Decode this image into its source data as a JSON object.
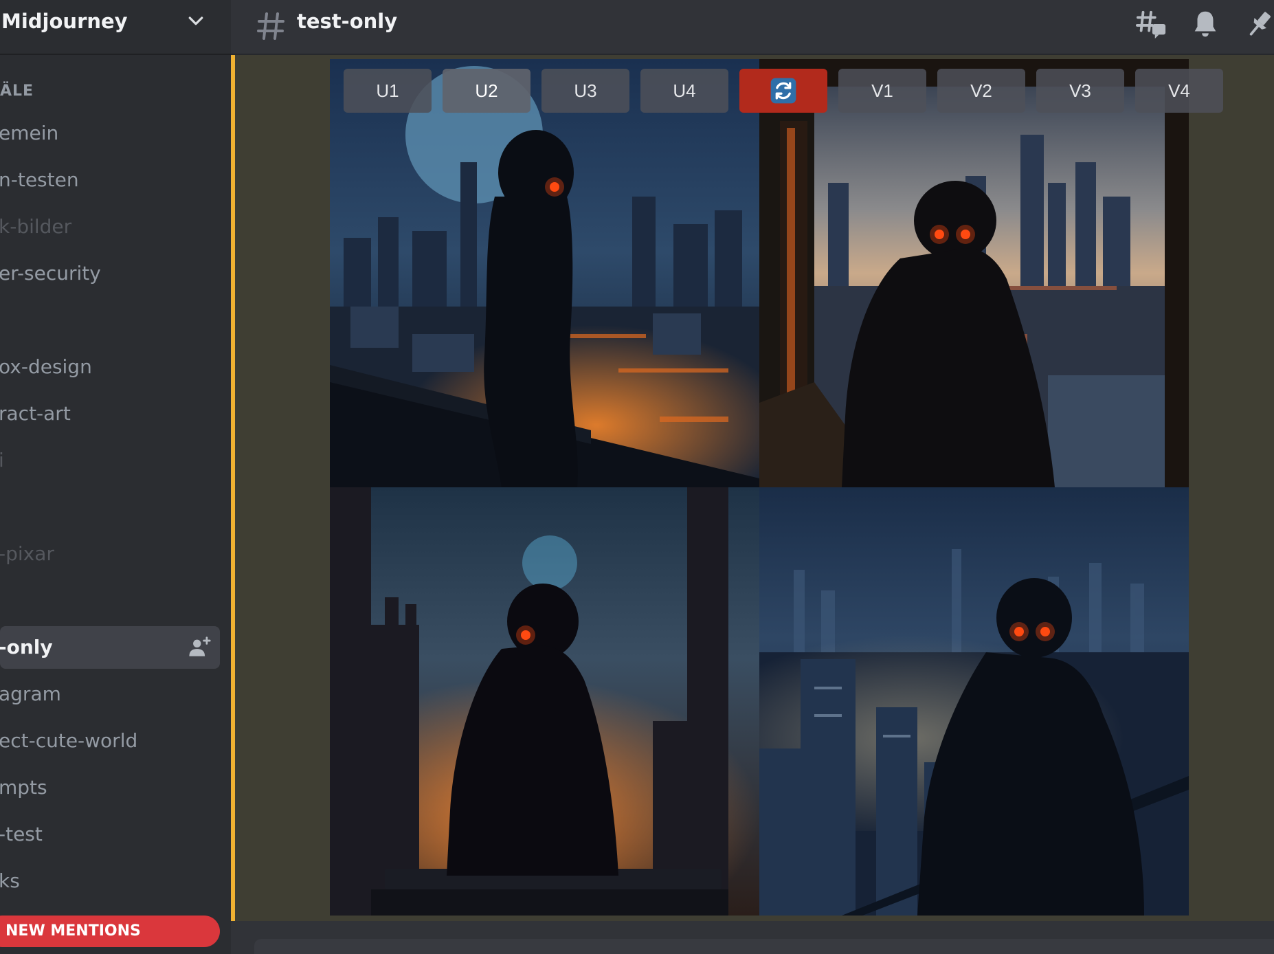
{
  "server": {
    "name": "Midjourney",
    "menu_icon": "chevron-down-icon"
  },
  "sidebar": {
    "category_label": "ÄLE",
    "channels": [
      {
        "label": "emein",
        "state": "normal"
      },
      {
        "label": "n-testen",
        "state": "normal"
      },
      {
        "label": "k-bilder",
        "state": "muted"
      },
      {
        "label": "er-security",
        "state": "normal"
      },
      {
        "label": "ox-design",
        "state": "normal"
      },
      {
        "label": "ract-art",
        "state": "normal"
      },
      {
        "label": "i",
        "state": "muted"
      },
      {
        "label": "-pixar",
        "state": "muted"
      },
      {
        "label": "-only",
        "state": "active"
      },
      {
        "label": "agram",
        "state": "normal"
      },
      {
        "label": "ect-cute-world",
        "state": "normal"
      },
      {
        "label": "mpts",
        "state": "normal"
      },
      {
        "label": "-test",
        "state": "normal"
      },
      {
        "label": "ks",
        "state": "normal"
      }
    ],
    "active_channel_action_icon": "add-member-icon",
    "new_mentions_label": "NEW MENTIONS"
  },
  "header": {
    "channel_icon": "hash-icon",
    "channel_name": "test-only",
    "icons": [
      "threads-icon",
      "bell-icon",
      "pin-icon"
    ]
  },
  "message": {
    "image_grid_panels": 4,
    "actions": [
      {
        "label": "U1",
        "state": "normal"
      },
      {
        "label": "U2",
        "state": "selected"
      },
      {
        "label": "U3",
        "state": "normal"
      },
      {
        "label": "U4",
        "state": "normal"
      },
      {
        "label": "",
        "icon": "reroll-icon",
        "state": "reroll"
      },
      {
        "label": "V1",
        "state": "normal"
      },
      {
        "label": "V2",
        "state": "normal"
      },
      {
        "label": "V3",
        "state": "normal"
      },
      {
        "label": "V4",
        "state": "normal"
      }
    ]
  },
  "colors": {
    "sidebar_bg": "#2b2d31",
    "chat_bg": "#313338",
    "mention_highlight_bg": "#3f3e33",
    "mention_bar": "#f0b232",
    "new_mentions_bg": "#da373c",
    "reroll_button": "#b22a1c",
    "glowing_eyes": "#ff5a1f"
  }
}
